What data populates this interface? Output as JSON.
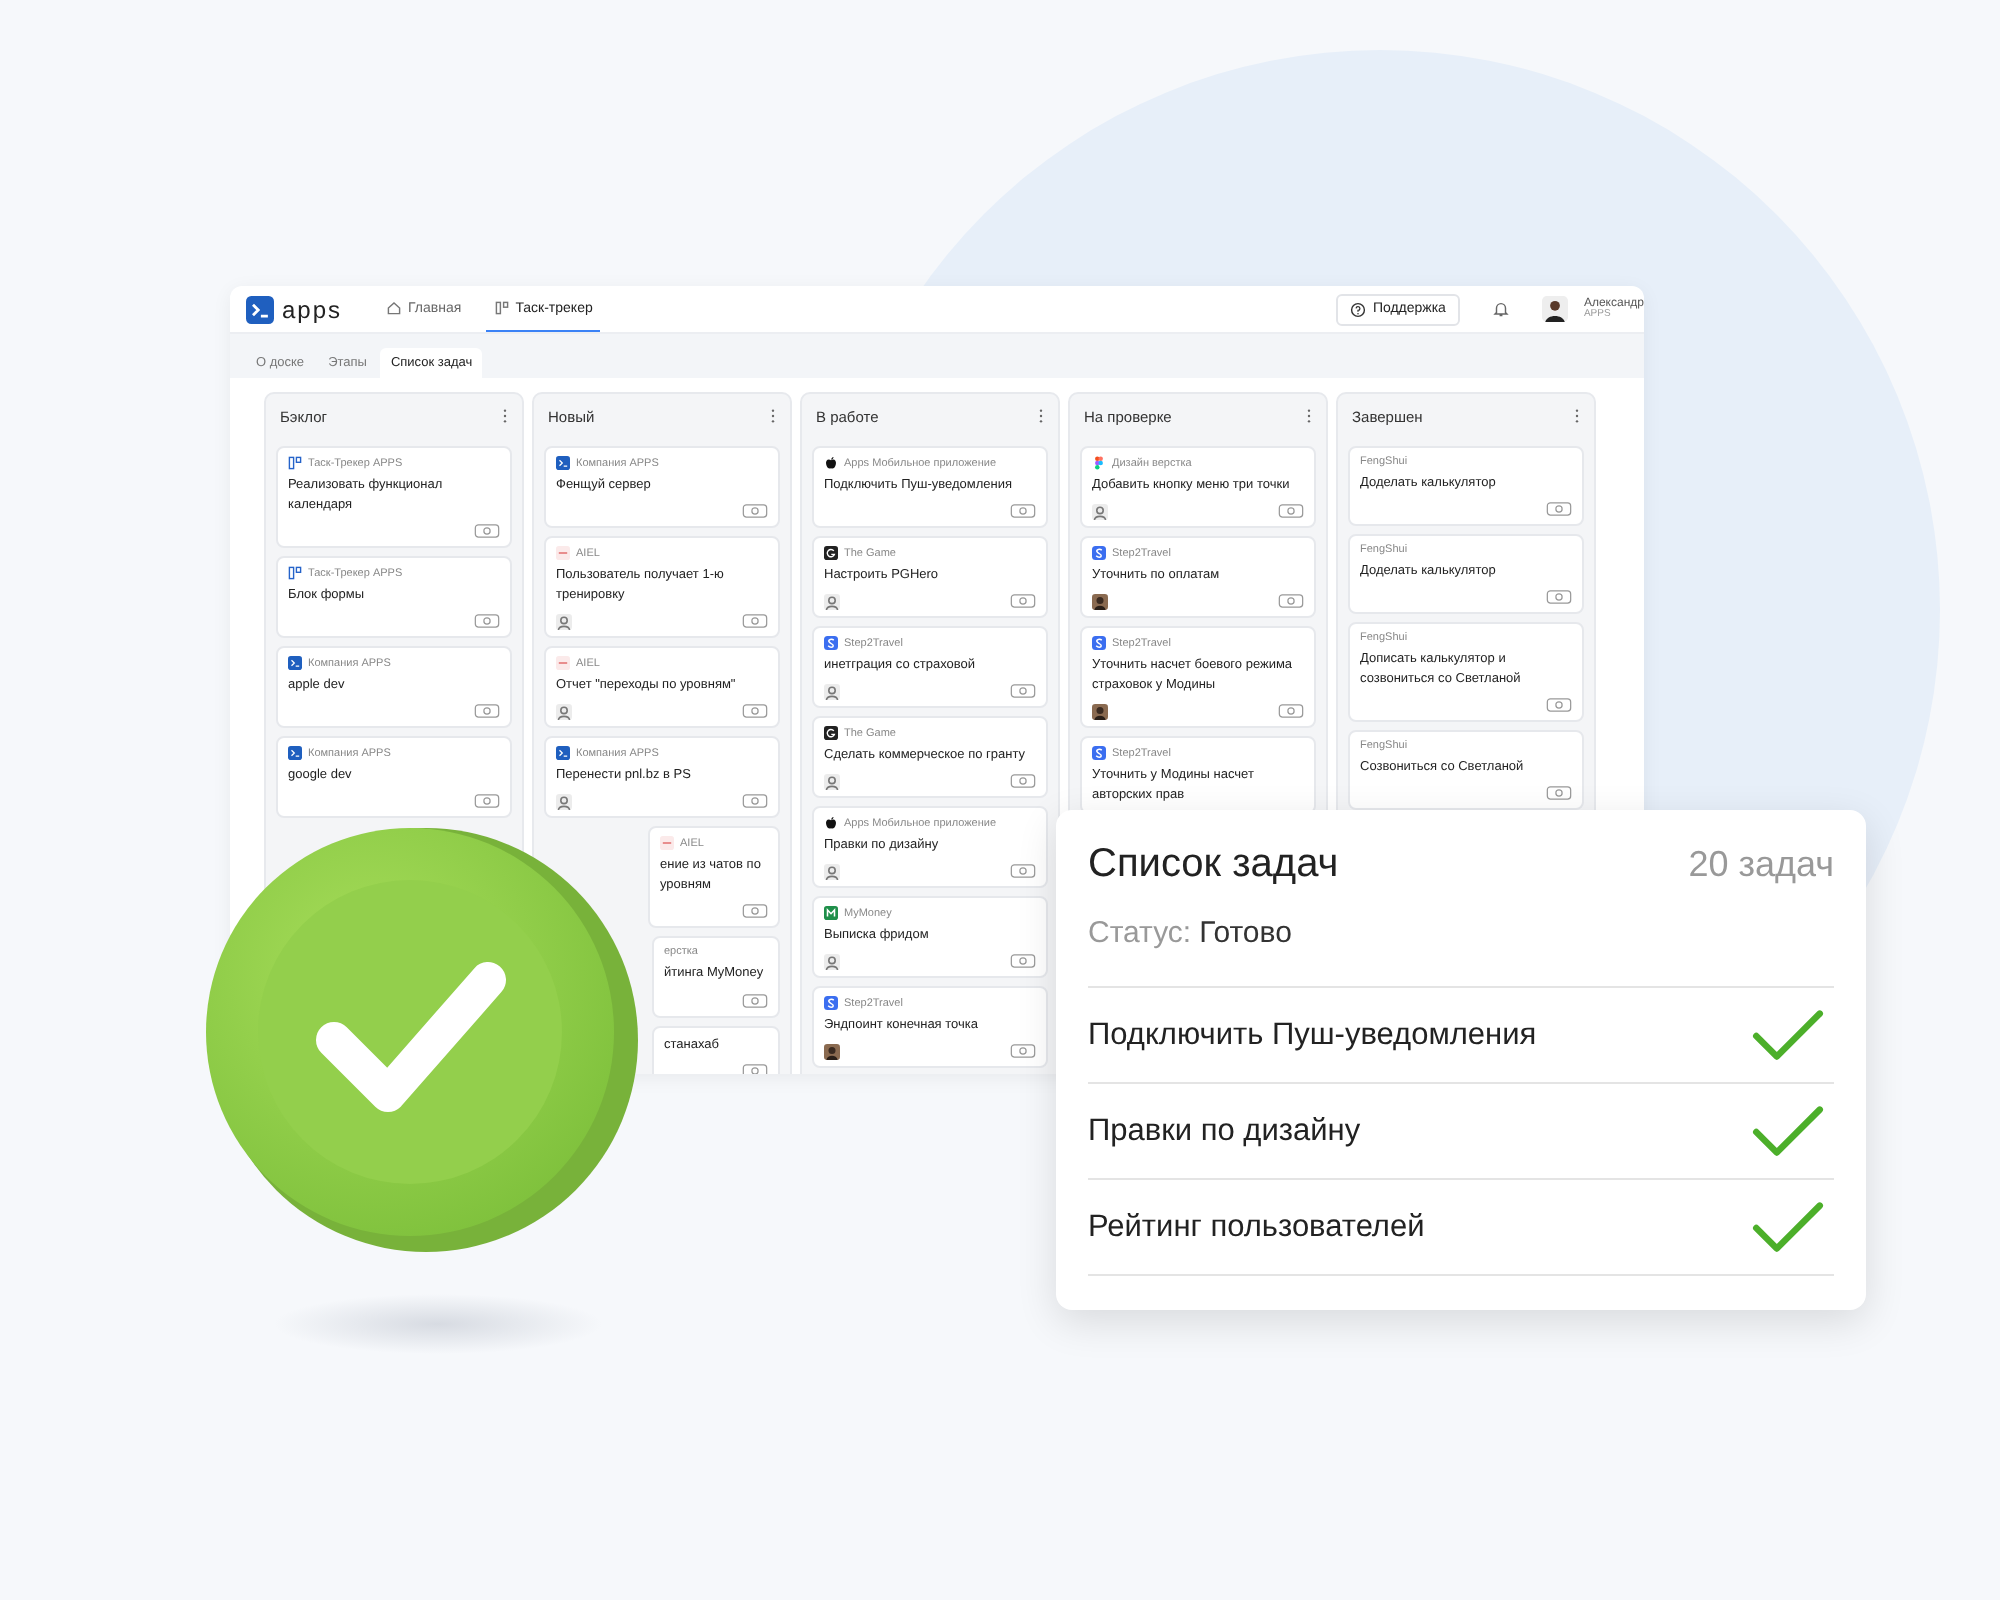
{
  "header": {
    "logo": "apps",
    "nav": [
      {
        "label": "Главная",
        "kind": "home",
        "selected": false
      },
      {
        "label": "Таск-трекер",
        "kind": "tracker",
        "selected": true
      }
    ],
    "support": "Поддержка",
    "user": {
      "name": "Александр",
      "company": "APPS"
    }
  },
  "tabs": [
    {
      "label": "О доске",
      "selected": false
    },
    {
      "label": "Этапы",
      "selected": false
    },
    {
      "label": "Список задач",
      "selected": true
    }
  ],
  "columns": [
    {
      "title": "Бэклог",
      "cards": [
        {
          "kind": "card",
          "project": {
            "kind": "tracker",
            "name": "Таск-Трекер APPS"
          },
          "title": "Реализовать функционал календаря"
        },
        {
          "kind": "card",
          "project": {
            "kind": "tracker",
            "name": "Таск-Трекер APPS"
          },
          "title": "Блок формы"
        },
        {
          "kind": "card",
          "project": {
            "kind": "apps",
            "name": "Компания APPS"
          },
          "title": "apple dev"
        },
        {
          "kind": "card",
          "project": {
            "kind": "apps",
            "name": "Компания APPS"
          },
          "title": "google dev"
        }
      ]
    },
    {
      "title": "Новый",
      "cards": [
        {
          "kind": "card",
          "project": {
            "kind": "apps",
            "name": "Компания APPS"
          },
          "title": "Фенщуй сервер"
        },
        {
          "kind": "card",
          "project": {
            "kind": "aiel",
            "name": "AIEL"
          },
          "title": "Пользователь получает 1-ю тренировку",
          "assignee": {
            "kind": "generic"
          }
        },
        {
          "kind": "card",
          "project": {
            "kind": "aiel",
            "name": "AIEL"
          },
          "title": "Отчет \"переходы по уровням\"",
          "assignee": {
            "kind": "generic"
          }
        },
        {
          "kind": "card",
          "project": {
            "kind": "apps",
            "name": "Компания APPS"
          },
          "title": "Перенести pnl.bz в PS",
          "assignee": {
            "kind": "generic"
          }
        },
        {
          "kind": "partly-covered",
          "project": {
            "kind": "aiel",
            "name": "AIEL"
          },
          "title": "ение из чатов по уровням"
        },
        {
          "kind": "covered",
          "project": {
            "kind": "text",
            "name": "ерстка"
          },
          "title": "йтинга MyMoney"
        },
        {
          "kind": "covered",
          "title": "станахаб"
        }
      ]
    },
    {
      "title": "В работе",
      "cards": [
        {
          "kind": "card",
          "project": {
            "kind": "apple",
            "name": "Apps Мобильное приложение"
          },
          "title": "Подключить Пуш-уведомления"
        },
        {
          "kind": "card",
          "project": {
            "kind": "game",
            "name": "The Game"
          },
          "title": "Настроить PGHero",
          "assignee": {
            "kind": "generic"
          }
        },
        {
          "kind": "card",
          "project": {
            "kind": "step",
            "name": "Step2Travel"
          },
          "title": "инетграция со страховой",
          "assignee": {
            "kind": "generic"
          }
        },
        {
          "kind": "card",
          "project": {
            "kind": "game",
            "name": "The Game"
          },
          "title": "Сделать коммерческое по гранту",
          "assignee": {
            "kind": "generic"
          }
        },
        {
          "kind": "card",
          "project": {
            "kind": "apple",
            "name": "Apps Мобильное приложение"
          },
          "title": "Правки по дизайну",
          "assignee": {
            "kind": "generic"
          }
        },
        {
          "kind": "card",
          "project": {
            "kind": "mymoney",
            "name": "MyMoney"
          },
          "title": "Выписка фридом",
          "assignee": {
            "kind": "generic"
          }
        },
        {
          "kind": "card",
          "project": {
            "kind": "step",
            "name": "Step2Travel"
          },
          "title": "Эндпоинт конечная точка",
          "assignee": {
            "kind": "photo"
          }
        }
      ]
    },
    {
      "title": "На проверке",
      "cards": [
        {
          "kind": "card",
          "project": {
            "kind": "figma",
            "name": "Дизайн верстка"
          },
          "title": "Добавить кнопку меню три точки",
          "assignee": {
            "kind": "generic"
          }
        },
        {
          "kind": "card",
          "project": {
            "kind": "step",
            "name": "Step2Travel"
          },
          "title": "Уточнить по оплатам",
          "assignee": {
            "kind": "photo"
          }
        },
        {
          "kind": "card",
          "project": {
            "kind": "step",
            "name": "Step2Travel"
          },
          "title": "Уточнить насчет боевого режима страховок у Модины",
          "assignee": {
            "kind": "photo"
          }
        },
        {
          "kind": "cut-off",
          "project": {
            "kind": "step",
            "name": "Step2Travel"
          },
          "title": "Уточнить у Модины насчет авторских прав"
        }
      ]
    },
    {
      "title": "Завершен",
      "cards": [
        {
          "kind": "card",
          "project": {
            "kind": "text",
            "name": "FengShui"
          },
          "title": "Доделать калькулятор"
        },
        {
          "kind": "card",
          "project": {
            "kind": "text",
            "name": "FengShui"
          },
          "title": "Доделать калькулятор"
        },
        {
          "kind": "card",
          "project": {
            "kind": "text",
            "name": "FengShui"
          },
          "title": "Дописать калькулятор и созвониться со Светланой"
        },
        {
          "kind": "card",
          "project": {
            "kind": "text",
            "name": "FengShui"
          },
          "title": "Созвониться со Светланой"
        }
      ]
    }
  ],
  "summary": {
    "title": "Список задач",
    "count": "20 задач",
    "status_label": "Статус:",
    "status": "Готово",
    "items": [
      {
        "label": "Подключить Пуш-уведомления",
        "done": true
      },
      {
        "label": "Правки по дизайну",
        "done": true
      },
      {
        "label": "Рейтинг пользователей",
        "done": true
      }
    ]
  }
}
